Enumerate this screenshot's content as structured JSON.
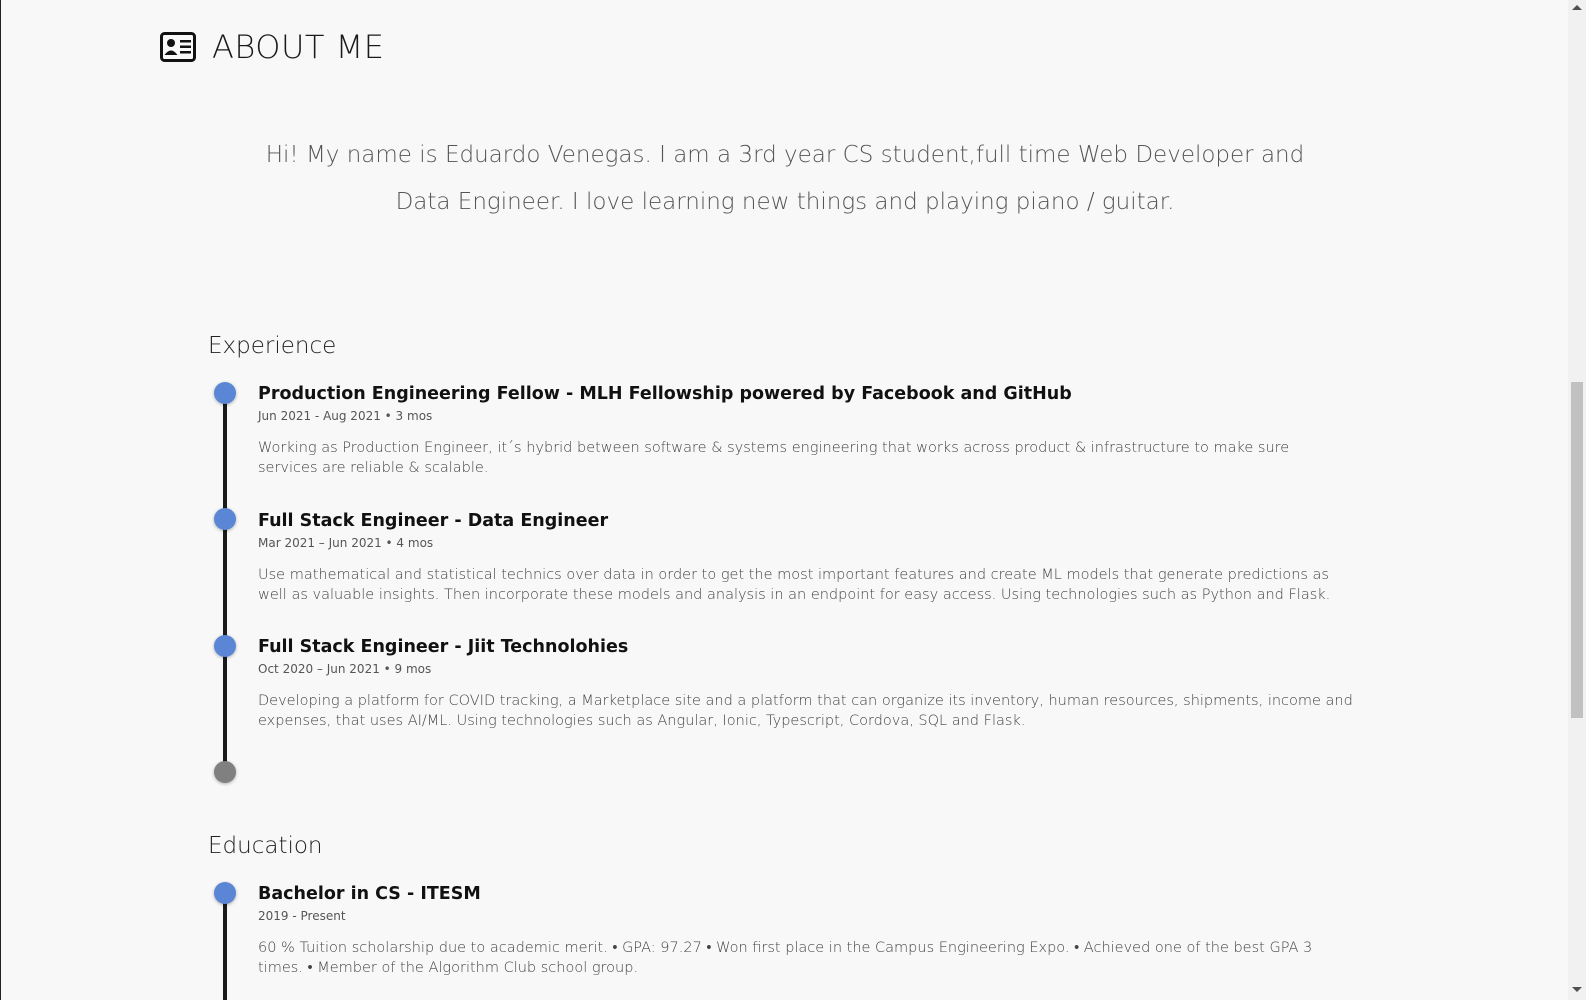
{
  "about": {
    "title": "ABOUT ME",
    "icon": "id-card-icon",
    "intro_line1": "Hi! My name is Eduardo Venegas. I am a 3rd year CS student,full time Web Developer and",
    "intro_line2": "Data Engineer. I love learning new things and playing piano / guitar."
  },
  "experience": {
    "title": "Experience",
    "items": [
      {
        "title": "Production Engineering Fellow - MLH Fellowship powered by Facebook and GitHub",
        "date": "Jun 2021 - Aug 2021 • 3 mos",
        "description": "Working as Production Engineer, it´s hybrid between software & systems engineering that works across product & infrastructure to make sure services are reliable & scalable."
      },
      {
        "title": "Full Stack Engineer - Data Engineer",
        "date": "Mar 2021 – Jun 2021 • 4 mos",
        "description": "Use mathematical and statistical technics over data in order to get the most important features and create ML models that generate predictions as well as valuable insights. Then incorporate these models and analysis in an endpoint for easy access. Using technologies such as Python and Flask."
      },
      {
        "title": "Full Stack Engineer - Jiit Technolohies",
        "date": "Oct 2020 – Jun 2021 • 9 mos",
        "description": "Developing a platform for COVID tracking, a Marketplace site and a platform that can organize its inventory, human resources, shipments, income and expenses, that uses AI/ML. Using technologies such as Angular, Ionic, Typescript, Cordova, SQL and Flask."
      }
    ]
  },
  "education": {
    "title": "Education",
    "items": [
      {
        "title": "Bachelor in CS - ITESM",
        "date": "2019 - Present",
        "description": "60 % Tuition scholarship due to academic merit. • GPA: 97.27 • Won first place in the Campus Engineering Expo. • Achieved one of the best GPA 3 times. • Member of the Algorithm Club school group."
      }
    ]
  },
  "colors": {
    "timeline_dot": "#5b86d6",
    "timeline_end_dot": "#808080",
    "timeline_line": "#1a1a1a"
  }
}
